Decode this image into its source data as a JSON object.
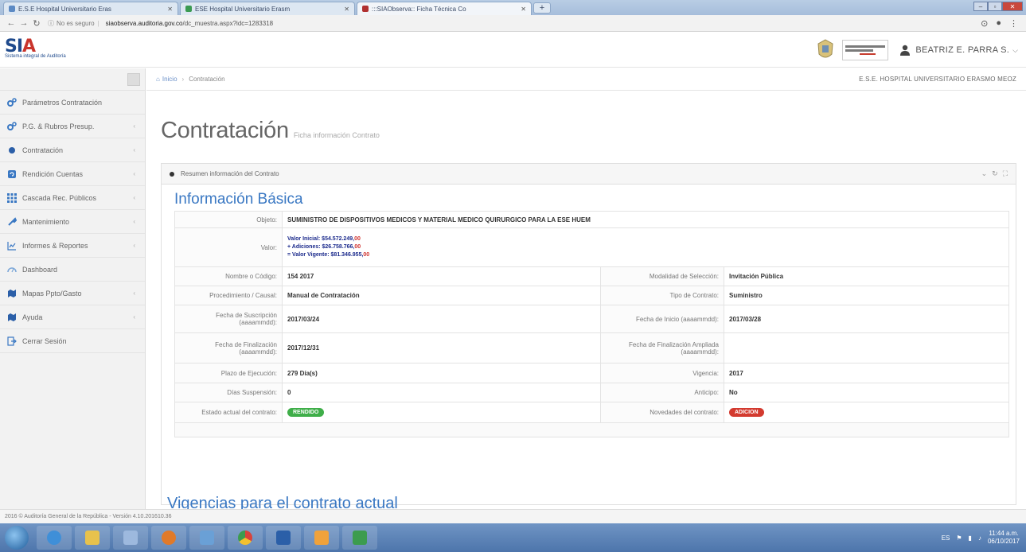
{
  "browser": {
    "tabs": [
      {
        "label": "E.S.E Hospital Universitario Eras",
        "active": false
      },
      {
        "label": "ESE Hospital Universitario Erasm",
        "active": false
      },
      {
        "label": ":::SIAObserva:: Ficha Técnica Co",
        "active": true
      }
    ],
    "address": {
      "security": "No es seguro",
      "url_host": "siaobserva.auditoria.gov.co",
      "url_path": "/dc_muestra.aspx?idc=1283318"
    }
  },
  "header": {
    "logo_text_main": "SI",
    "logo_text_accent": "A",
    "logo_sub": "Sistema integral de Auditoría",
    "user_name": "BEATRIZ E. PARRA S."
  },
  "sidebar": {
    "items": [
      {
        "label": "Parámetros Contratación",
        "icon": "gears-icon",
        "has_submenu": false
      },
      {
        "label": "P.G. & Rubros Presup.",
        "icon": "gears-icon",
        "has_submenu": true
      },
      {
        "label": "Contratación",
        "icon": "circle-icon",
        "has_submenu": true
      },
      {
        "label": "Rendición Cuentas",
        "icon": "refresh-icon",
        "has_submenu": true
      },
      {
        "label": "Cascada Rec. Públicos",
        "icon": "grid-icon",
        "has_submenu": true
      },
      {
        "label": "Mantenimiento",
        "icon": "wrench-icon",
        "has_submenu": true
      },
      {
        "label": "Informes & Reportes",
        "icon": "chart-icon",
        "has_submenu": true
      },
      {
        "label": "Dashboard",
        "icon": "dashboard-icon",
        "has_submenu": false
      },
      {
        "label": "Mapas Ppto/Gasto",
        "icon": "map-icon",
        "has_submenu": true
      },
      {
        "label": "Ayuda",
        "icon": "help-icon",
        "has_submenu": true
      },
      {
        "label": "Cerrar Sesión",
        "icon": "logout-icon",
        "has_submenu": false
      }
    ]
  },
  "breadcrumb": {
    "home": "Inicio",
    "current": "Contratación",
    "entity": "E.S.E. HOSPITAL UNIVERSITARIO ERASMO MEOZ"
  },
  "page": {
    "title": "Contratación",
    "subtitle": "Ficha información Contrato"
  },
  "portlet": {
    "title": "Resumen información del Contrato"
  },
  "basic_info": {
    "section_title": "Información Básica",
    "objeto_label": "Objeto:",
    "objeto_value": "SUMINISTRO DE DISPOSITIVOS MEDICOS Y MATERIAL MEDICO QUIRURGICO PARA LA ESE HUEM",
    "valor_label": "Valor:",
    "valor_inicial": "Valor Inicial: $54.572.249,",
    "valor_inicial_cents": "00",
    "adiciones": "+ Adiciones: $26.758.766,",
    "adiciones_cents": "00",
    "valor_vigente": "= Valor Vigente: $81.346.955,",
    "valor_vigente_cents": "00",
    "rows": [
      {
        "l1": "Nombre o Código:",
        "v1": "154 2017",
        "l2": "Modalidad de Selección:",
        "v2": "Invitación Pública"
      },
      {
        "l1": "Procedimiento / Causal:",
        "v1": "Manual de Contratación",
        "l2": "Tipo de Contrato:",
        "v2": "Suministro"
      },
      {
        "l1": "Fecha de Suscripción (aaaammdd):",
        "v1": "2017/03/24",
        "l2": "Fecha de Inicio (aaaammdd):",
        "v2": "2017/03/28"
      },
      {
        "l1": "Fecha de Finalización (aaaammdd):",
        "v1": "2017/12/31",
        "l2": "Fecha de Finalización Ampliada (aaaammdd):",
        "v2": ""
      },
      {
        "l1": "Plazo de Ejecución:",
        "v1": "279 Día(s)",
        "l2": "Vigencia:",
        "v2": "2017"
      },
      {
        "l1": "Días Suspensión:",
        "v1": "0",
        "l2": "Anticipo:",
        "v2": "No"
      }
    ],
    "estado_label": "Estado actual del contrato:",
    "estado_value": "RENDIDO",
    "novedades_label": "Novedades del contrato:",
    "novedades_value": "ADICION"
  },
  "vigencias_title": "Vigencias para el contrato actual",
  "footer": {
    "text": "2016 © Auditoría General de la República - Versión 4.10.201610.36"
  },
  "taskbar": {
    "time": "11:44 a.m.",
    "date": "06/10/2017"
  },
  "colors": {
    "accent_blue": "#3a78c3",
    "badge_green": "#3fae49",
    "badge_red": "#d33a2f"
  }
}
